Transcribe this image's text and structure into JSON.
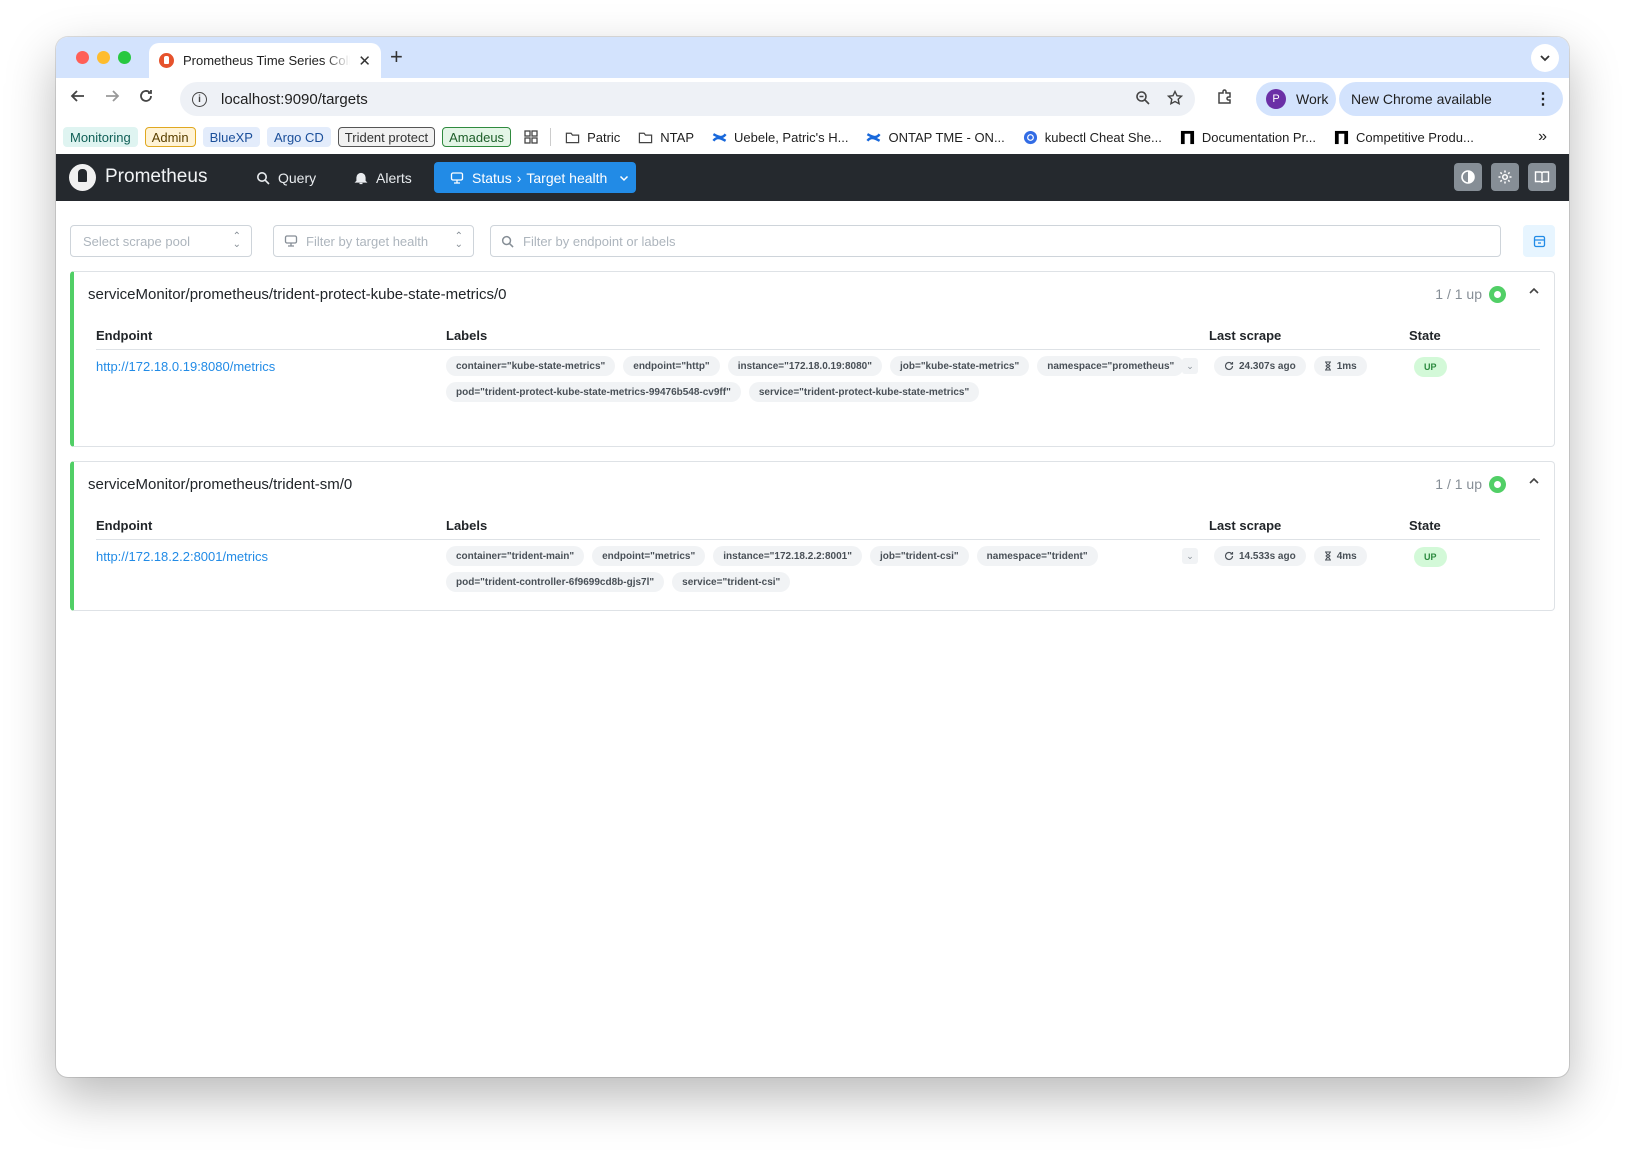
{
  "browser": {
    "tab_title": "Prometheus Time Series Collection and Processing Server",
    "url": "localhost:9090/targets",
    "profile_initial": "P",
    "profile_name": "Work",
    "update_label": "New Chrome available",
    "bookmarks_chips": [
      {
        "label": "Monitoring",
        "bg": "#dff4f1",
        "border": "#dff4f1",
        "color": "#0f5f56"
      },
      {
        "label": "Admin",
        "bg": "#fff3d6",
        "border": "#e0a820",
        "color": "#5b4000"
      },
      {
        "label": "BlueXP",
        "bg": "#e3ecfb",
        "border": "#e3ecfb",
        "color": "#1b4f9a"
      },
      {
        "label": "Argo CD",
        "bg": "#e3ecfb",
        "border": "#e3ecfb",
        "color": "#1b4f9a"
      },
      {
        "label": "Trident protect",
        "bg": "#f1f1f1",
        "border": "#555555",
        "color": "#333333"
      },
      {
        "label": "Amadeus",
        "bg": "#e3f5e6",
        "border": "#2f8a3e",
        "color": "#1d5e29"
      }
    ],
    "bookmarks": [
      {
        "label": "Patric",
        "icon": "folder-icon"
      },
      {
        "label": "NTAP",
        "icon": "folder-icon"
      },
      {
        "label": "Uebele, Patric's H...",
        "icon": "confluence-icon"
      },
      {
        "label": "ONTAP TME - ON...",
        "icon": "confluence-icon"
      },
      {
        "label": "kubectl Cheat She...",
        "icon": "kubernetes-icon"
      },
      {
        "label": "Documentation Pr...",
        "icon": "netapp-icon"
      },
      {
        "label": "Competitive Produ...",
        "icon": "netapp-icon"
      }
    ]
  },
  "prometheus": {
    "brand": "Prometheus",
    "nav": {
      "query": "Query",
      "alerts": "Alerts",
      "status": "Status",
      "status_sub": "Target health"
    },
    "filters": {
      "scrape_pool_placeholder": "Select scrape pool",
      "health_placeholder": "Filter by target health",
      "search_placeholder": "Filter by endpoint or labels"
    },
    "columns": {
      "endpoint": "Endpoint",
      "labels": "Labels",
      "last_scrape": "Last scrape",
      "state": "State"
    },
    "pools": [
      {
        "name": "serviceMonitor/prometheus/trident-protect-kube-state-metrics/0",
        "count": "1 / 1 up",
        "health_color": "#51cf66",
        "target": {
          "endpoint": "http://172.18.0.19:8080/metrics",
          "labels": [
            "container=\"kube-state-metrics\"",
            "endpoint=\"http\"",
            "instance=\"172.18.0.19:8080\"",
            "job=\"kube-state-metrics\"",
            "namespace=\"prometheus\"",
            "pod=\"trident-protect-kube-state-metrics-99476b548-cv9ff\"",
            "service=\"trident-protect-kube-state-metrics\""
          ],
          "last_scrape": "24.307s ago",
          "duration": "1ms",
          "state": "UP"
        }
      },
      {
        "name": "serviceMonitor/prometheus/trident-sm/0",
        "count": "1 / 1 up",
        "health_color": "#51cf66",
        "target": {
          "endpoint": "http://172.18.2.2:8001/metrics",
          "labels": [
            "container=\"trident-main\"",
            "endpoint=\"metrics\"",
            "instance=\"172.18.2.2:8001\"",
            "job=\"trident-csi\"",
            "namespace=\"trident\"",
            "pod=\"trident-controller-6f9699cd8b-gjs7l\"",
            "service=\"trident-csi\""
          ],
          "last_scrape": "14.533s ago",
          "duration": "4ms",
          "state": "UP"
        }
      }
    ]
  }
}
